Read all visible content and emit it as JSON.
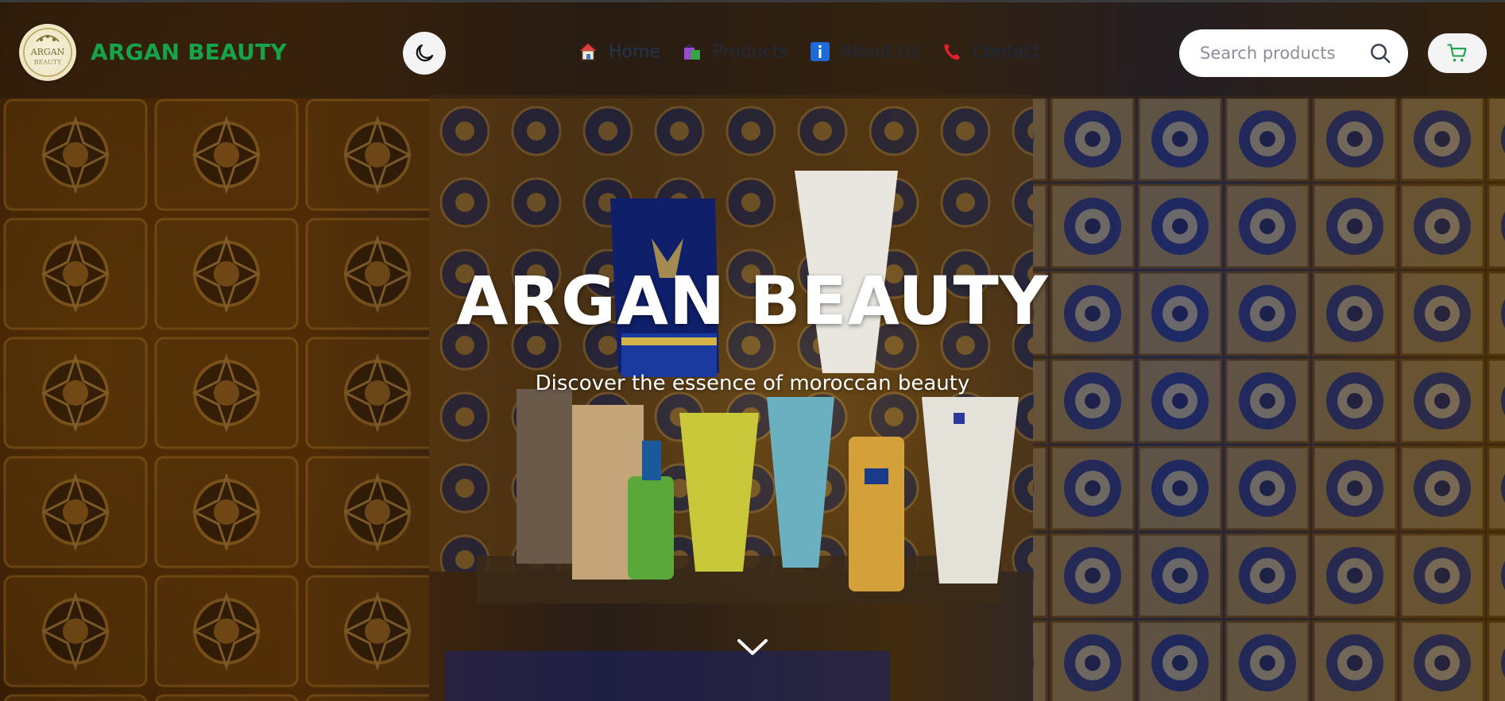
{
  "header": {
    "logo_text": "ARGAN\nBEAUTY",
    "brand": "ARGAN BEAUTY",
    "theme_toggle_icon": "moon-icon",
    "nav": [
      {
        "label": "Home",
        "icon": "house-icon"
      },
      {
        "label": "Products",
        "icon": "shopping-bags-icon"
      },
      {
        "label": "About Us",
        "icon": "info-icon"
      },
      {
        "label": "Contact",
        "icon": "telephone-icon"
      }
    ],
    "search": {
      "placeholder": "Search products",
      "icon": "search-icon"
    },
    "cart_icon": "cart-icon"
  },
  "hero": {
    "title": "ARGAN BEAUTY",
    "subtitle": "Discover the essence of moroccan beauty",
    "scroll_icon": "chevron-down-icon"
  },
  "colors": {
    "brand_green": "#16a34a",
    "nav_text": "#1f2a3c",
    "button_bg": "#f4f4f5",
    "header_bg": "rgba(40,28,16,0.55)"
  }
}
